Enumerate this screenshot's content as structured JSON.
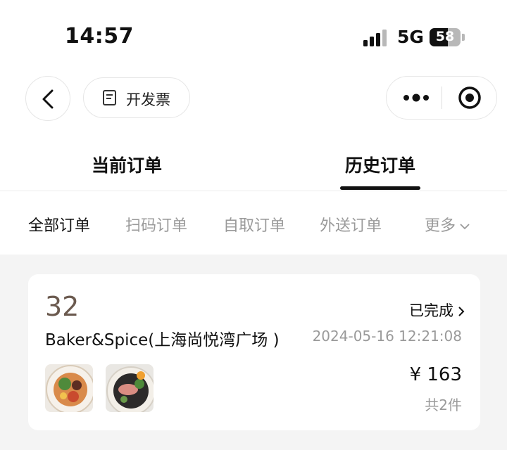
{
  "status_bar": {
    "time": "14:57",
    "network": "5G",
    "battery": "58",
    "battery_level": 0.58
  },
  "nav": {
    "invoice_label": "开发票"
  },
  "tabs": [
    {
      "label": "当前订单",
      "active": false
    },
    {
      "label": "历史订单",
      "active": true
    }
  ],
  "filters": [
    {
      "label": "全部订单",
      "active": true
    },
    {
      "label": "扫码订单",
      "active": false
    },
    {
      "label": "自取订单",
      "active": false
    },
    {
      "label": "外送订单",
      "active": false
    },
    {
      "label": "更多",
      "active": false
    }
  ],
  "order": {
    "number": "32",
    "status": "已完成",
    "store": "Baker&Spice(上海尚悦湾广场 )",
    "datetime": "2024-05-16 12:21:08",
    "price": "¥ 163",
    "item_count": "共2件"
  },
  "colors": {
    "accent": "#111111",
    "muted": "#9a9a9a",
    "order_number": "#6b5a4f",
    "background_gray": "#f4f4f4"
  }
}
